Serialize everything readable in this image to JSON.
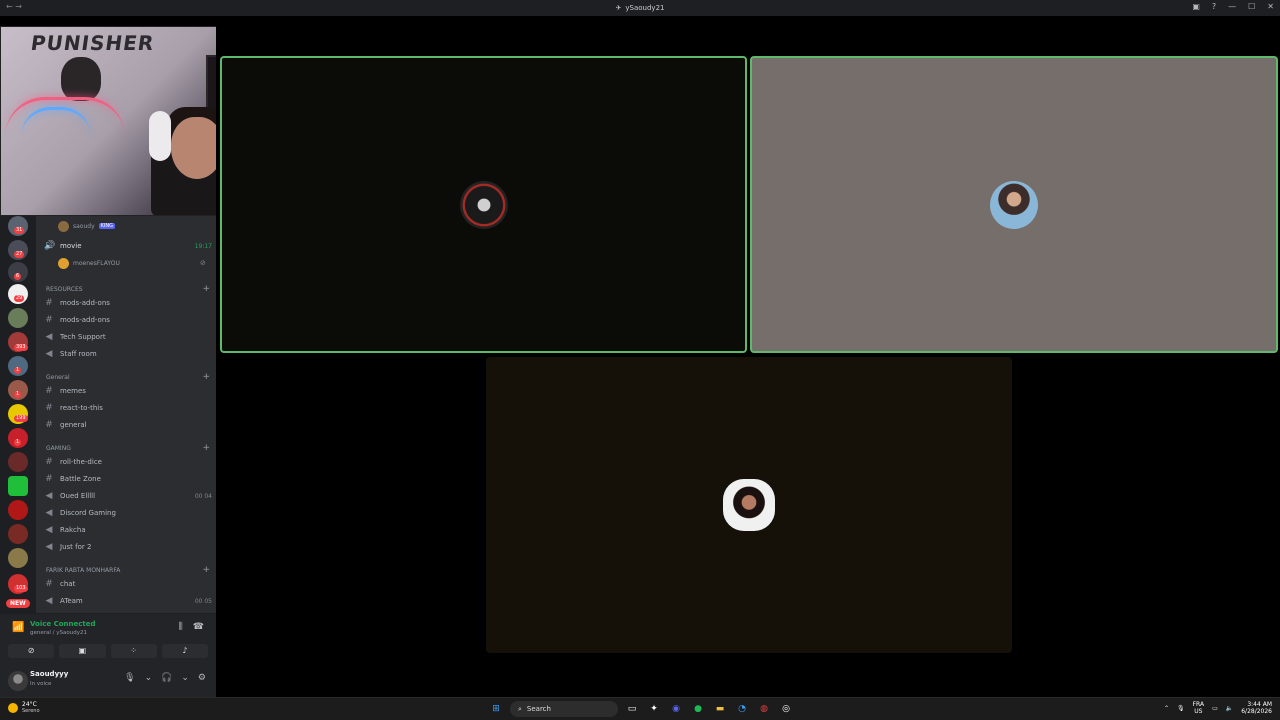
{
  "window": {
    "title": "ySaoudy21"
  },
  "webcam": {
    "sign_text": "PUNISHER"
  },
  "servers": {
    "badges": [
      "31",
      "27",
      "6",
      "29",
      "393",
      "1",
      "1",
      "199",
      "1",
      "103"
    ],
    "new_label": "NEW"
  },
  "channels": {
    "top_user": {
      "name": "saoudy",
      "tag": "KING"
    },
    "movie": {
      "name": "movie",
      "time": "19:17"
    },
    "movie_user": {
      "name": "moenesFLAYOU"
    },
    "cat_resources": "RESOURCES",
    "mods1": "mods-add-ons",
    "mods2": "mods-add-ons",
    "tech": "Tech Support",
    "staff": "Staff room",
    "cat_general": "General",
    "memes": "memes",
    "react": "react-to-this",
    "general": "general",
    "cat_gaming": "GAMING",
    "roll": "roll-the-dice",
    "battle": "Battle Zone",
    "oued": "Oued Elllll",
    "oued_count": "00  04",
    "discord_gaming": "Discord Gaming",
    "rakcha": "Rakcha",
    "justfor2": "Just for 2",
    "cat_farik": "FARIK RABTA MONHARFA",
    "chat": "chat",
    "ateam": "ATeam",
    "ateam_count": "00  05"
  },
  "voice": {
    "status": "Voice Connected",
    "location": "general / ySaoudy21"
  },
  "user": {
    "name": "Saoudyyy",
    "status": "In voice"
  },
  "taskbar": {
    "weather_temp": "24°C",
    "weather_cond": "Sereno",
    "search_placeholder": "Search",
    "lang_1": "FRA",
    "lang_2": "US",
    "time": "3:44 AM",
    "date": "6/28/2026"
  },
  "colors": {
    "speaking": "#5fb96c",
    "voice_connected": "#23a55a",
    "badge": "#f23f43"
  }
}
